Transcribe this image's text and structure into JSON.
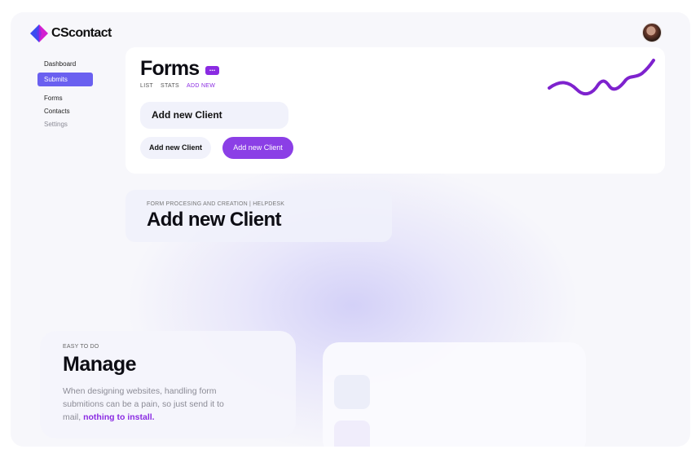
{
  "app": {
    "logo_text": "CScontact",
    "avatar_alt": "user-avatar"
  },
  "sidebar": {
    "items": [
      {
        "label": "Dashboard",
        "state": "normal"
      },
      {
        "label": "Submits",
        "state": "active"
      },
      {
        "label": "Forms",
        "state": "normal"
      },
      {
        "label": "Contacts",
        "state": "normal"
      },
      {
        "label": "Settings",
        "state": "muted"
      }
    ]
  },
  "forms_card": {
    "title": "Forms",
    "badge_icon": "more-dots-icon",
    "tabs": [
      {
        "label": "LIST",
        "active": false
      },
      {
        "label": "STATS",
        "active": false
      },
      {
        "label": "ADD NEW",
        "active": true
      }
    ],
    "client_field_label": "Add new Client",
    "secondary_button": "Add new Client",
    "primary_button": "Add new Client"
  },
  "helpdesk": {
    "subtitle": "FORM PROCESING AND CREATION | HELPDESK",
    "title": "Add new Client"
  },
  "manage": {
    "kicker": "EASY TO DO",
    "title": "Manage",
    "body_text": "When designing websites, handling form submitions can be a pain, so just send it to mail,",
    "body_highlight": "nothing to install."
  },
  "colors": {
    "accent": "#8a2be2",
    "sidebar_active": "#6a60f0",
    "logo_blue": "#3b4cf0",
    "logo_magenta": "#c026d3"
  }
}
